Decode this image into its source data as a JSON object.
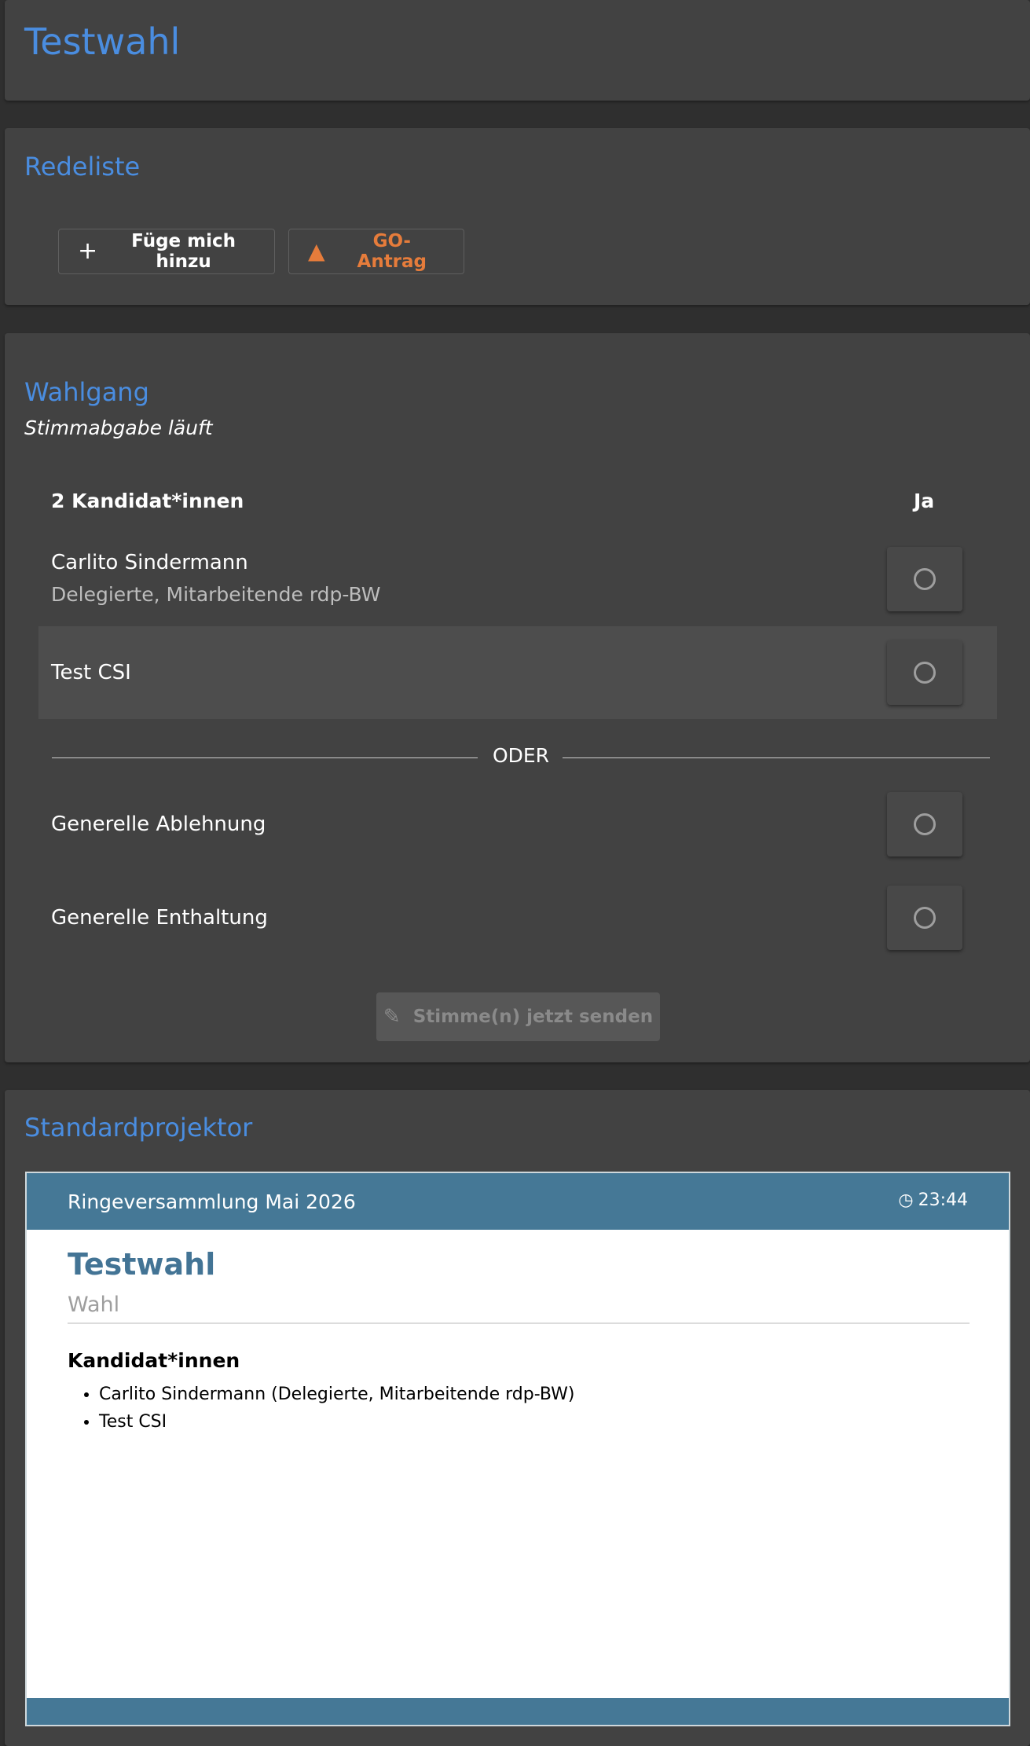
{
  "header": {
    "title": "Testwahl"
  },
  "speakers": {
    "title": "Redeliste",
    "add_label": "Füge mich hinzu",
    "go_label": "GO-Antrag"
  },
  "ballot": {
    "title": "Wahlgang",
    "status": "Stimmabgabe läuft",
    "candidates_header": "2 Kandidat*innen",
    "yes_header": "Ja",
    "candidates": [
      {
        "name": "Carlito Sindermann",
        "detail": "Delegierte, Mitarbeitende rdp-BW"
      },
      {
        "name": "Test CSI"
      }
    ],
    "or_label": "ODER",
    "general_reject": "Generelle Ablehnung",
    "general_abstain": "Generelle Enthaltung",
    "submit_label": "Stimme(n) jetzt senden"
  },
  "projector": {
    "title": "Standardprojektor",
    "event_name": "Ringeversammlung Mai 2026",
    "clock": "23:44",
    "slide_title": "Testwahl",
    "slide_subtitle": "Wahl",
    "section_label": "Kandidat*innen",
    "candidates": [
      "Carlito Sindermann (Delegierte, Mitarbeitende rdp-BW)",
      "Test CSI"
    ]
  },
  "colors": {
    "accent": "#4a8de0",
    "warning": "#e67c3b",
    "projector_bar": "#457896",
    "card_bg": "#424242",
    "page_bg": "#2f2f2f"
  },
  "icons": [
    "plus-icon",
    "warning-icon",
    "radio-unchecked-icon",
    "ballot-icon",
    "clock-icon"
  ]
}
